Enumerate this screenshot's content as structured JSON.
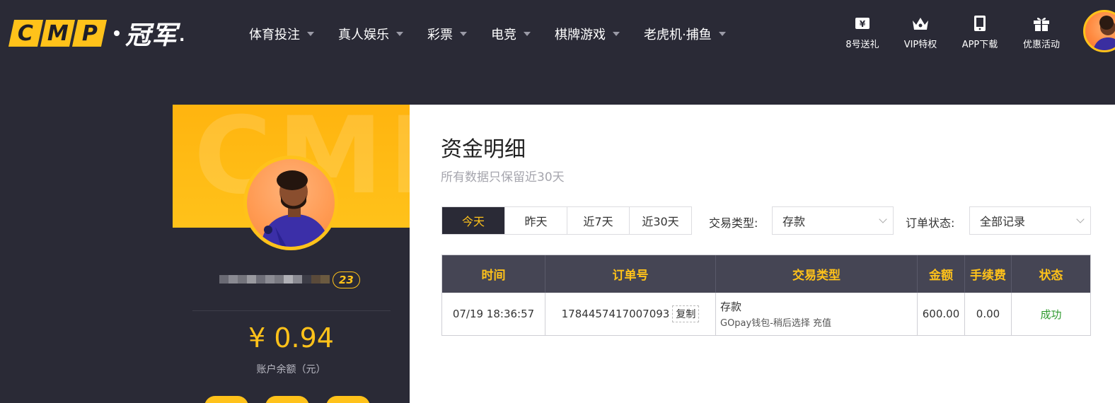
{
  "logo": {
    "letters": [
      "C",
      "M",
      "P"
    ],
    "text": "冠军",
    "tail": "."
  },
  "nav": [
    {
      "label": "体育投注"
    },
    {
      "label": "真人娱乐"
    },
    {
      "label": "彩票"
    },
    {
      "label": "电竞"
    },
    {
      "label": "棋牌游戏"
    },
    {
      "label": "老虎机·捕鱼"
    }
  ],
  "quick_links": [
    {
      "label": "8号送礼",
      "icon": "ticket-icon"
    },
    {
      "label": "VIP特权",
      "icon": "crown-icon"
    },
    {
      "label": "APP下载",
      "icon": "phone-icon"
    },
    {
      "label": "优惠活动",
      "icon": "gift-icon"
    }
  ],
  "profile": {
    "watermark": "CMP",
    "vip_badge": "23",
    "balance": "¥ 0.94",
    "balance_label": "账户余额（元）"
  },
  "main": {
    "title": "资金明细",
    "subtitle": "所有数据只保留近30天",
    "tabs": [
      {
        "label": "今天",
        "active": true
      },
      {
        "label": "昨天",
        "active": false
      },
      {
        "label": "近7天",
        "active": false
      },
      {
        "label": "近30天",
        "active": false
      }
    ],
    "filters": {
      "type_label": "交易类型:",
      "type_value": "存款",
      "status_label": "订单状态:",
      "status_value": "全部记录"
    },
    "table": {
      "headers": [
        "时间",
        "订单号",
        "交易类型",
        "金额",
        "手续费",
        "状态"
      ],
      "rows": [
        {
          "time": "07/19 18:36:57",
          "order_no": "1784457417007093",
          "copy_label": "复制",
          "type_main": "存款",
          "type_sub": "GOpay钱包-稍后选择 充值",
          "amount": "600.00",
          "fee": "0.00",
          "status": "成功"
        }
      ]
    }
  },
  "colors": {
    "accent": "#ffc21a",
    "header_bg": "#2a2a36",
    "table_header_bg": "#454554",
    "success": "#2f9a2f"
  }
}
